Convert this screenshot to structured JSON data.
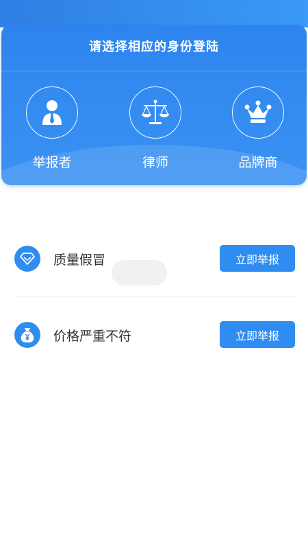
{
  "header": {
    "title": "请选择相应的身份登陆"
  },
  "roles": [
    {
      "label": "举报者",
      "icon": "reporter-person-icon"
    },
    {
      "label": "律师",
      "icon": "scales-icon"
    },
    {
      "label": "品牌商",
      "icon": "crown-icon"
    }
  ],
  "reports": [
    {
      "label": "质量假冒",
      "icon": "diamond-icon",
      "button": "立即举报"
    },
    {
      "label": "价格严重不符",
      "icon": "money-bag-icon",
      "button": "立即举报"
    }
  ],
  "colors": {
    "primary": "#2f8cf0",
    "header_gradient_start": "#2d84ee",
    "header_gradient_end": "#3a92f3",
    "text": "#333333"
  }
}
